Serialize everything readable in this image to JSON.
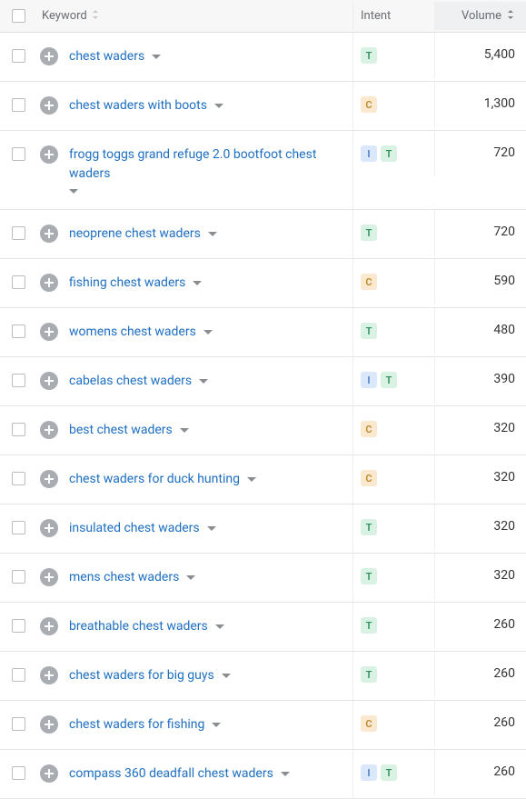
{
  "header": {
    "keyword_label": "Keyword",
    "intent_label": "Intent",
    "volume_label": "Volume"
  },
  "intent_letters": {
    "T": "T",
    "C": "C",
    "I": "I"
  },
  "rows": [
    {
      "keyword": "chest waders",
      "intents": [
        "T"
      ],
      "volume": "5,400"
    },
    {
      "keyword": "chest waders with boots",
      "intents": [
        "C"
      ],
      "volume": "1,300"
    },
    {
      "keyword": "frogg toggs grand refuge 2.0 bootfoot chest waders",
      "intents": [
        "I",
        "T"
      ],
      "volume": "720"
    },
    {
      "keyword": "neoprene chest waders",
      "intents": [
        "T"
      ],
      "volume": "720"
    },
    {
      "keyword": "fishing chest waders",
      "intents": [
        "C"
      ],
      "volume": "590"
    },
    {
      "keyword": "womens chest waders",
      "intents": [
        "T"
      ],
      "volume": "480"
    },
    {
      "keyword": "cabelas chest waders",
      "intents": [
        "I",
        "T"
      ],
      "volume": "390"
    },
    {
      "keyword": "best chest waders",
      "intents": [
        "C"
      ],
      "volume": "320"
    },
    {
      "keyword": "chest waders for duck hunting",
      "intents": [
        "C"
      ],
      "volume": "320"
    },
    {
      "keyword": "insulated chest waders",
      "intents": [
        "T"
      ],
      "volume": "320"
    },
    {
      "keyword": "mens chest waders",
      "intents": [
        "T"
      ],
      "volume": "320"
    },
    {
      "keyword": "breathable chest waders",
      "intents": [
        "T"
      ],
      "volume": "260"
    },
    {
      "keyword": "chest waders for big guys",
      "intents": [
        "T"
      ],
      "volume": "260"
    },
    {
      "keyword": "chest waders for fishing",
      "intents": [
        "C"
      ],
      "volume": "260"
    },
    {
      "keyword": "compass 360 deadfall chest waders",
      "intents": [
        "I",
        "T"
      ],
      "volume": "260"
    }
  ]
}
